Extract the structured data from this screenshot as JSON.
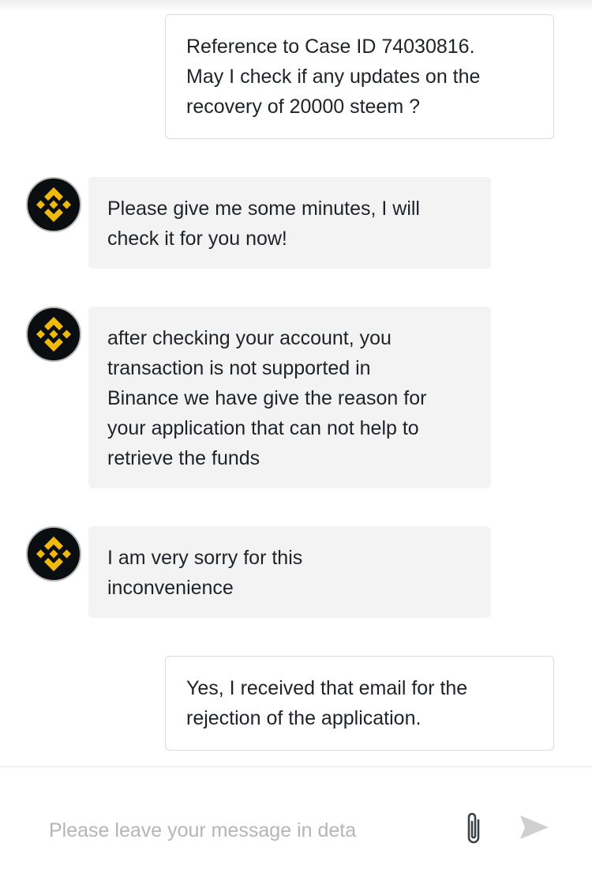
{
  "colors": {
    "brand": "#F0B90B",
    "avatar_bg": "#0B0E11",
    "agent_bubble": "#F3F3F3",
    "user_bubble_border": "#DCDCDC",
    "placeholder": "#B5B5B5",
    "send_icon": "#CFCFCF"
  },
  "messages": [
    {
      "sender": "user",
      "text": "Reference to Case ID 74030816.\nMay I check if any updates on the\nrecovery of 20000 steem ?"
    },
    {
      "sender": "agent",
      "avatar_icon": "binance-logo-icon",
      "text": "Please give me some minutes, I will\ncheck it for you now!"
    },
    {
      "sender": "agent",
      "avatar_icon": "binance-logo-icon",
      "text": "after checking your account, you\ntransaction is not supported in\nBinance we have give the reason for\nyour application that can not help to\nretrieve the funds"
    },
    {
      "sender": "agent",
      "avatar_icon": "binance-logo-icon",
      "text": "I am very sorry for this\ninconvenience"
    },
    {
      "sender": "user",
      "text": "Yes, I received that email for the\nrejection of the application."
    }
  ],
  "composer": {
    "placeholder": "Please leave your message in deta",
    "value": "",
    "attach_icon": "paperclip-icon",
    "send_icon": "send-icon"
  }
}
